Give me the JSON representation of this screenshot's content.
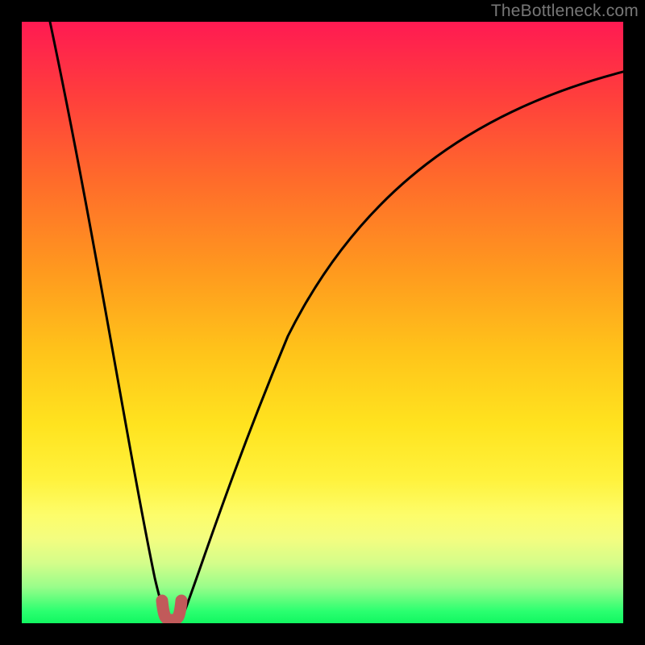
{
  "watermark": "TheBottleneck.com",
  "chart_data": {
    "type": "line",
    "title": "",
    "xlabel": "",
    "ylabel": "",
    "xlim": [
      0,
      100
    ],
    "ylim": [
      0,
      100
    ],
    "gradient_meaning": "vertical gradient from red (high bottleneck) at top to green (no bottleneck) at bottom",
    "series": [
      {
        "name": "left-falling-curve",
        "description": "steep curve descending from top-left toward trough",
        "x": [
          4,
          8,
          12,
          16,
          18,
          20,
          22,
          23,
          24
        ],
        "y": [
          100,
          75,
          50,
          25,
          14,
          6,
          2,
          1,
          1
        ]
      },
      {
        "name": "right-rising-curve",
        "description": "curve rising from trough toward upper-right with decreasing slope",
        "x": [
          26,
          28,
          32,
          40,
          50,
          60,
          70,
          80,
          90,
          100
        ],
        "y": [
          2,
          6,
          18,
          40,
          58,
          70,
          78,
          84,
          88,
          91
        ]
      },
      {
        "name": "trough-marker",
        "description": "small rounded U-shaped marker at minimum",
        "x": [
          23,
          24,
          25,
          26
        ],
        "y": [
          4,
          1,
          1,
          4
        ],
        "stroke": "#c15a5a",
        "stroke_width_px": 14
      }
    ],
    "trough_x_approx_percent": 24
  }
}
